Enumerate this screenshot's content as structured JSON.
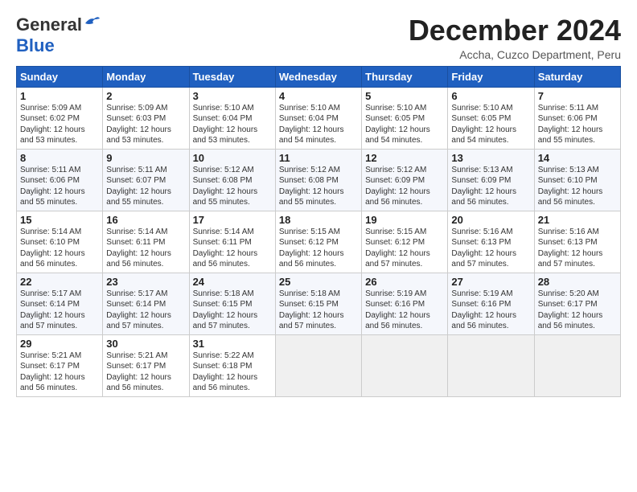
{
  "logo": {
    "general": "General",
    "blue": "Blue"
  },
  "title": "December 2024",
  "subtitle": "Accha, Cuzco Department, Peru",
  "days_of_week": [
    "Sunday",
    "Monday",
    "Tuesday",
    "Wednesday",
    "Thursday",
    "Friday",
    "Saturday"
  ],
  "weeks": [
    [
      {
        "day": "1",
        "sunrise": "Sunrise: 5:09 AM",
        "sunset": "Sunset: 6:02 PM",
        "daylight": "Daylight: 12 hours and 53 minutes."
      },
      {
        "day": "2",
        "sunrise": "Sunrise: 5:09 AM",
        "sunset": "Sunset: 6:03 PM",
        "daylight": "Daylight: 12 hours and 53 minutes."
      },
      {
        "day": "3",
        "sunrise": "Sunrise: 5:10 AM",
        "sunset": "Sunset: 6:04 PM",
        "daylight": "Daylight: 12 hours and 53 minutes."
      },
      {
        "day": "4",
        "sunrise": "Sunrise: 5:10 AM",
        "sunset": "Sunset: 6:04 PM",
        "daylight": "Daylight: 12 hours and 54 minutes."
      },
      {
        "day": "5",
        "sunrise": "Sunrise: 5:10 AM",
        "sunset": "Sunset: 6:05 PM",
        "daylight": "Daylight: 12 hours and 54 minutes."
      },
      {
        "day": "6",
        "sunrise": "Sunrise: 5:10 AM",
        "sunset": "Sunset: 6:05 PM",
        "daylight": "Daylight: 12 hours and 54 minutes."
      },
      {
        "day": "7",
        "sunrise": "Sunrise: 5:11 AM",
        "sunset": "Sunset: 6:06 PM",
        "daylight": "Daylight: 12 hours and 55 minutes."
      }
    ],
    [
      {
        "day": "8",
        "sunrise": "Sunrise: 5:11 AM",
        "sunset": "Sunset: 6:06 PM",
        "daylight": "Daylight: 12 hours and 55 minutes."
      },
      {
        "day": "9",
        "sunrise": "Sunrise: 5:11 AM",
        "sunset": "Sunset: 6:07 PM",
        "daylight": "Daylight: 12 hours and 55 minutes."
      },
      {
        "day": "10",
        "sunrise": "Sunrise: 5:12 AM",
        "sunset": "Sunset: 6:08 PM",
        "daylight": "Daylight: 12 hours and 55 minutes."
      },
      {
        "day": "11",
        "sunrise": "Sunrise: 5:12 AM",
        "sunset": "Sunset: 6:08 PM",
        "daylight": "Daylight: 12 hours and 55 minutes."
      },
      {
        "day": "12",
        "sunrise": "Sunrise: 5:12 AM",
        "sunset": "Sunset: 6:09 PM",
        "daylight": "Daylight: 12 hours and 56 minutes."
      },
      {
        "day": "13",
        "sunrise": "Sunrise: 5:13 AM",
        "sunset": "Sunset: 6:09 PM",
        "daylight": "Daylight: 12 hours and 56 minutes."
      },
      {
        "day": "14",
        "sunrise": "Sunrise: 5:13 AM",
        "sunset": "Sunset: 6:10 PM",
        "daylight": "Daylight: 12 hours and 56 minutes."
      }
    ],
    [
      {
        "day": "15",
        "sunrise": "Sunrise: 5:14 AM",
        "sunset": "Sunset: 6:10 PM",
        "daylight": "Daylight: 12 hours and 56 minutes."
      },
      {
        "day": "16",
        "sunrise": "Sunrise: 5:14 AM",
        "sunset": "Sunset: 6:11 PM",
        "daylight": "Daylight: 12 hours and 56 minutes."
      },
      {
        "day": "17",
        "sunrise": "Sunrise: 5:14 AM",
        "sunset": "Sunset: 6:11 PM",
        "daylight": "Daylight: 12 hours and 56 minutes."
      },
      {
        "day": "18",
        "sunrise": "Sunrise: 5:15 AM",
        "sunset": "Sunset: 6:12 PM",
        "daylight": "Daylight: 12 hours and 56 minutes."
      },
      {
        "day": "19",
        "sunrise": "Sunrise: 5:15 AM",
        "sunset": "Sunset: 6:12 PM",
        "daylight": "Daylight: 12 hours and 57 minutes."
      },
      {
        "day": "20",
        "sunrise": "Sunrise: 5:16 AM",
        "sunset": "Sunset: 6:13 PM",
        "daylight": "Daylight: 12 hours and 57 minutes."
      },
      {
        "day": "21",
        "sunrise": "Sunrise: 5:16 AM",
        "sunset": "Sunset: 6:13 PM",
        "daylight": "Daylight: 12 hours and 57 minutes."
      }
    ],
    [
      {
        "day": "22",
        "sunrise": "Sunrise: 5:17 AM",
        "sunset": "Sunset: 6:14 PM",
        "daylight": "Daylight: 12 hours and 57 minutes."
      },
      {
        "day": "23",
        "sunrise": "Sunrise: 5:17 AM",
        "sunset": "Sunset: 6:14 PM",
        "daylight": "Daylight: 12 hours and 57 minutes."
      },
      {
        "day": "24",
        "sunrise": "Sunrise: 5:18 AM",
        "sunset": "Sunset: 6:15 PM",
        "daylight": "Daylight: 12 hours and 57 minutes."
      },
      {
        "day": "25",
        "sunrise": "Sunrise: 5:18 AM",
        "sunset": "Sunset: 6:15 PM",
        "daylight": "Daylight: 12 hours and 57 minutes."
      },
      {
        "day": "26",
        "sunrise": "Sunrise: 5:19 AM",
        "sunset": "Sunset: 6:16 PM",
        "daylight": "Daylight: 12 hours and 56 minutes."
      },
      {
        "day": "27",
        "sunrise": "Sunrise: 5:19 AM",
        "sunset": "Sunset: 6:16 PM",
        "daylight": "Daylight: 12 hours and 56 minutes."
      },
      {
        "day": "28",
        "sunrise": "Sunrise: 5:20 AM",
        "sunset": "Sunset: 6:17 PM",
        "daylight": "Daylight: 12 hours and 56 minutes."
      }
    ],
    [
      {
        "day": "29",
        "sunrise": "Sunrise: 5:21 AM",
        "sunset": "Sunset: 6:17 PM",
        "daylight": "Daylight: 12 hours and 56 minutes."
      },
      {
        "day": "30",
        "sunrise": "Sunrise: 5:21 AM",
        "sunset": "Sunset: 6:17 PM",
        "daylight": "Daylight: 12 hours and 56 minutes."
      },
      {
        "day": "31",
        "sunrise": "Sunrise: 5:22 AM",
        "sunset": "Sunset: 6:18 PM",
        "daylight": "Daylight: 12 hours and 56 minutes."
      },
      null,
      null,
      null,
      null
    ]
  ]
}
